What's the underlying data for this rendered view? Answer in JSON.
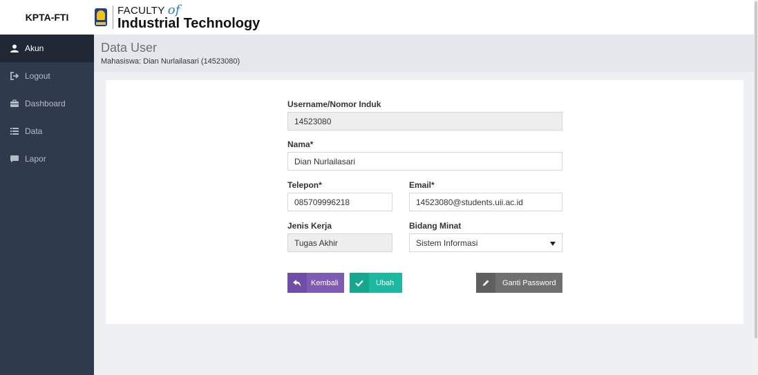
{
  "app": {
    "brand": "KPTA-FTI"
  },
  "logo": {
    "line1": "FACULTY",
    "of": "of",
    "line2": "Industrial Technology"
  },
  "sidebar": {
    "items": [
      {
        "label": "Akun",
        "icon": "user-icon",
        "active": true
      },
      {
        "label": "Logout",
        "icon": "logout-icon",
        "active": false
      },
      {
        "label": "Dashboard",
        "icon": "briefcase-icon",
        "active": false
      },
      {
        "label": "Data",
        "icon": "list-icon",
        "active": false
      },
      {
        "label": "Lapor",
        "icon": "comment-icon",
        "active": false
      }
    ]
  },
  "header": {
    "title": "Data User",
    "subtitle": "Mahasiswa: Dian Nurlailasari (14523080)"
  },
  "form": {
    "username_label": "Username/Nomor Induk",
    "username_value": "14523080",
    "nama_label": "Nama*",
    "nama_value": "Dian Nurlailasari",
    "telepon_label": "Telepon*",
    "telepon_value": "085709996218",
    "email_label": "Email*",
    "email_value": "14523080@students.uii.ac.id",
    "jenis_label": "Jenis Kerja",
    "jenis_value": "Tugas Akhir",
    "bidang_label": "Bidang Minat",
    "bidang_value": "Sistem Informasi"
  },
  "buttons": {
    "kembali": "Kembali",
    "ubah": "Ubah",
    "ganti_password": "Ganti Password"
  },
  "colors": {
    "sidebar_bg": "#2f3b4c",
    "kembali": "#7e5bb5",
    "ubah": "#1cb8a0",
    "ganti_password": "#707070"
  }
}
